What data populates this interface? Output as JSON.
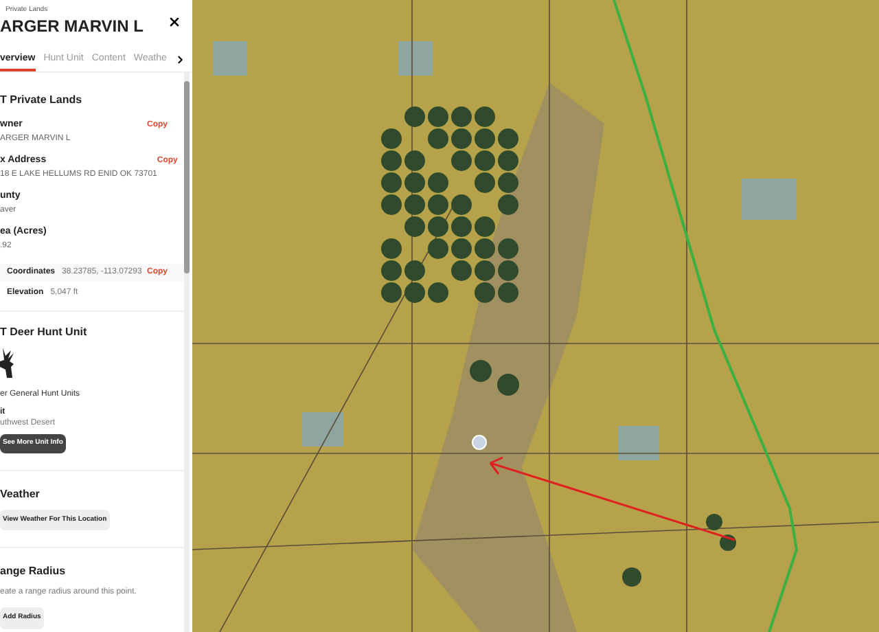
{
  "panel": {
    "breadcrumb": "Private Lands",
    "title": "ARGER MARVIN L",
    "tabs": [
      {
        "label": "verview",
        "selected": true
      },
      {
        "label": "Hunt Unit",
        "selected": false
      },
      {
        "label": "Content",
        "selected": false
      },
      {
        "label": "Weathe",
        "selected": false
      }
    ],
    "private_lands": {
      "heading": "T Private Lands",
      "fields": [
        {
          "label": "wner",
          "value": "ARGER MARVIN L",
          "copy": "Copy"
        },
        {
          "label": "x Address",
          "value": "18 E LAKE HELLUMS RD ENID OK 73701",
          "copy": "Copy"
        },
        {
          "label": "unty",
          "value": "aver"
        },
        {
          "label": "ea (Acres)",
          "value": ".92"
        }
      ],
      "coordinates": {
        "label": "Coordinates",
        "value": "38.23785, -113.07293",
        "copy": "Copy"
      },
      "elevation": {
        "label": "Elevation",
        "value": "5,047 ft"
      }
    },
    "hunt_unit": {
      "heading": "T Deer Hunt Unit",
      "type": "er General Hunt Units",
      "unit_label": "it",
      "unit_value": "uthwest Desert",
      "button": "See More Unit Info"
    },
    "weather": {
      "heading": "Veather",
      "button": "View Weather For This Location"
    },
    "range_radius": {
      "heading": "ange Radius",
      "description": "eate a range radius around this point.",
      "button": "Add Radius"
    }
  }
}
